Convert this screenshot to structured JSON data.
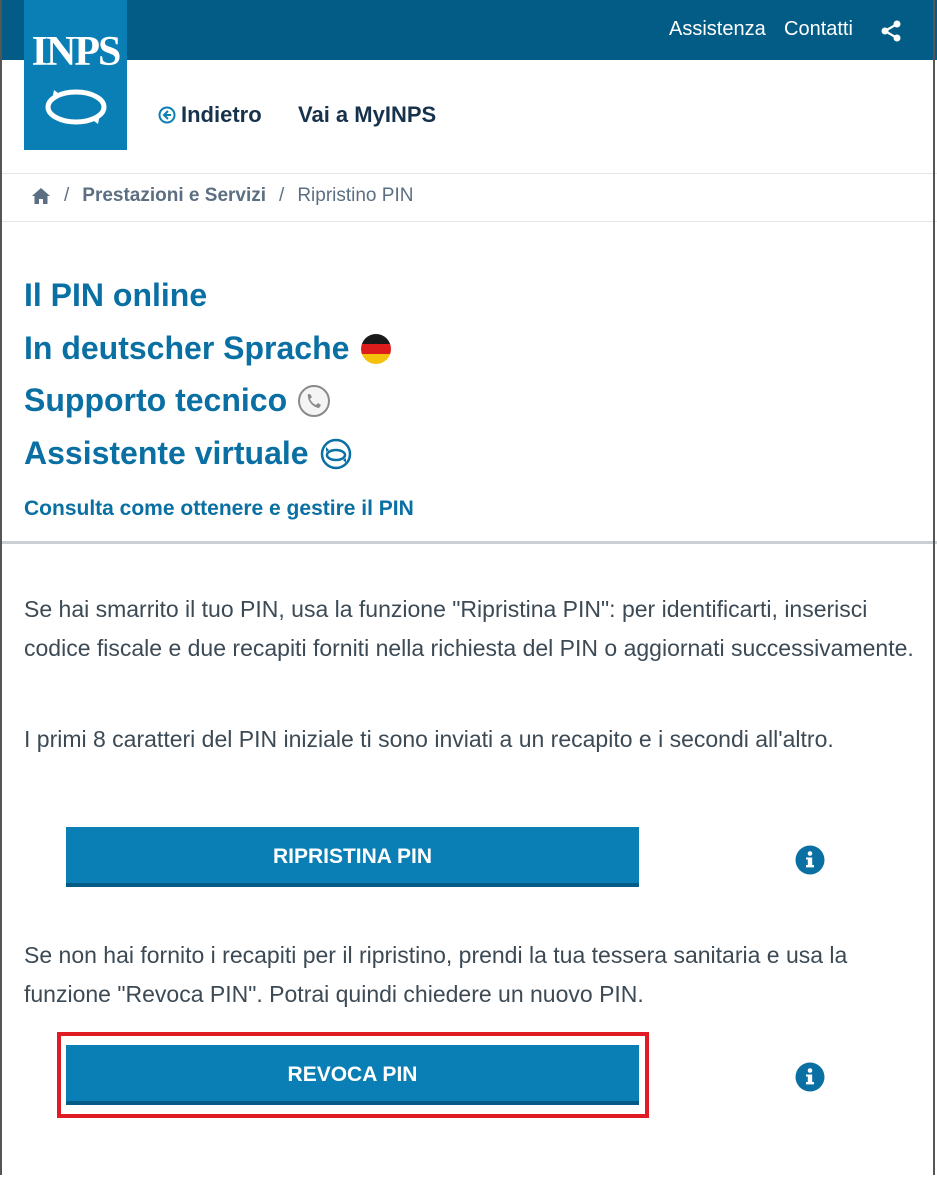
{
  "topbar": {
    "assistenza": "Assistenza",
    "contatti": "Contatti",
    "share_icon": "share-icon"
  },
  "logo": {
    "text": "INPS"
  },
  "header_nav": {
    "back": "Indietro",
    "myinps": "Vai a MyINPS"
  },
  "breadcrumb": {
    "home_icon": "home-icon",
    "items": [
      "Prestazioni e Servizi",
      "Ripristino PIN"
    ],
    "separator": "/"
  },
  "links": {
    "pin_online": "Il PIN online",
    "deutsch": "In deutscher Sprache",
    "supporto": "Supporto tecnico",
    "assistente": "Assistente virtuale",
    "consulta": "Consulta come ottenere e gestire il PIN"
  },
  "content": {
    "para_1": "Se hai smarrito il tuo PIN, usa la funzione \"Ripristina PIN\": per identificarti, inserisci codice fiscale e due recapiti forniti nella richiesta del PIN o aggiornati successivamente.",
    "para_2": "I primi 8 caratteri del PIN iniziale ti sono inviati a un recapito e i secondi all'altro.",
    "para_3": "Se non hai fornito i recapiti per il ripristino, prendi la tua tessera sanitaria e usa la funzione \"Revoca PIN\". Potrai quindi chiedere un nuovo PIN."
  },
  "buttons": {
    "ripristina": "RIPRISTINA PIN",
    "revoca": "REVOCA PIN"
  },
  "colors": {
    "topbar": "#035c85",
    "primary": "#0a7fb5",
    "link": "#0a6fa3",
    "highlight": "#e01b24"
  }
}
